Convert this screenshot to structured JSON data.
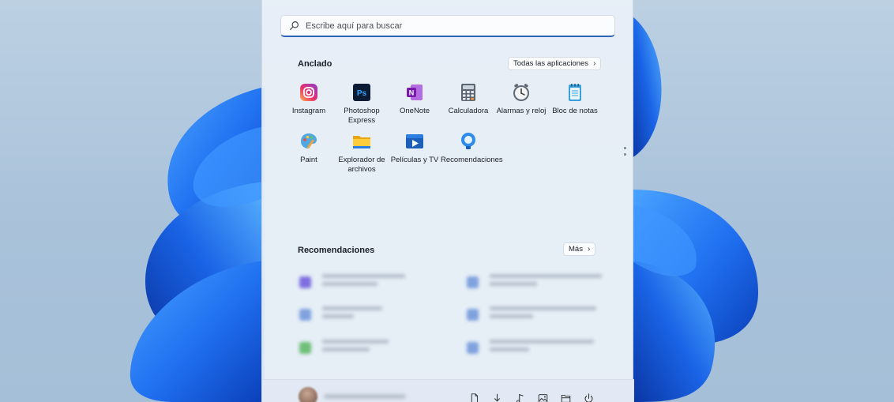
{
  "search": {
    "placeholder": "Escribe aquí para buscar"
  },
  "pinned": {
    "title": "Anclado",
    "all_apps_label": "Todas las aplicaciones",
    "apps": [
      {
        "label": "Instagram",
        "icon": "instagram-icon"
      },
      {
        "label": "Photoshop Express",
        "icon": "photoshop-express-icon"
      },
      {
        "label": "OneNote",
        "icon": "onenote-icon"
      },
      {
        "label": "Calculadora",
        "icon": "calculator-icon"
      },
      {
        "label": "Alarmas y reloj",
        "icon": "alarm-clock-icon"
      },
      {
        "label": "Bloc de notas",
        "icon": "notepad-icon"
      },
      {
        "label": "Paint",
        "icon": "paint-icon"
      },
      {
        "label": "Explorador de archivos",
        "icon": "file-explorer-icon"
      },
      {
        "label": "Películas y TV",
        "icon": "movies-tv-icon"
      },
      {
        "label": "Recomendaciones",
        "icon": "tips-icon"
      }
    ]
  },
  "recommended": {
    "title": "Recomendaciones",
    "more_label": "Más"
  },
  "footer": {
    "icons": [
      "document-icon",
      "download-icon",
      "music-icon",
      "image-icon",
      "folder-icon",
      "power-icon"
    ]
  },
  "colors": {
    "accent": "#2e62b8",
    "wallpaper_blue": "#1d6fe6"
  }
}
